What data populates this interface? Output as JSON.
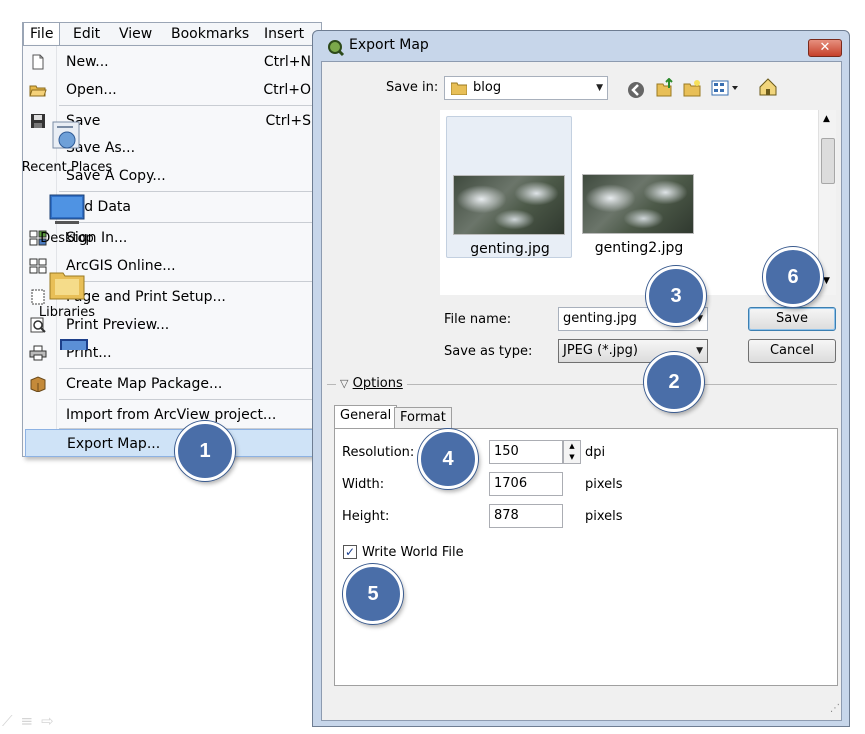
{
  "menubar": {
    "items": [
      "File",
      "Edit",
      "View",
      "Bookmarks",
      "Insert"
    ]
  },
  "file_menu": {
    "items": [
      {
        "label": "New...",
        "shortcut": "Ctrl+N",
        "icon": "new-document-icon"
      },
      {
        "label": "Open...",
        "shortcut": "Ctrl+O",
        "icon": "open-folder-icon"
      },
      {
        "label": "Save",
        "shortcut": "Ctrl+S",
        "icon": "save-disk-icon"
      },
      {
        "label": "Save As...",
        "shortcut": "",
        "icon": ""
      },
      {
        "label": "Save A Copy...",
        "shortcut": "",
        "icon": ""
      },
      {
        "label": "Add Data",
        "shortcut": "",
        "icon": ""
      },
      {
        "label": "Sign In...",
        "shortcut": "",
        "icon": "sign-in-icon"
      },
      {
        "label": "ArcGIS Online...",
        "shortcut": "",
        "icon": "arcgis-online-icon"
      },
      {
        "label": "Page and Print Setup...",
        "shortcut": "",
        "icon": "page-setup-icon"
      },
      {
        "label": "Print Preview...",
        "shortcut": "",
        "icon": "print-preview-icon"
      },
      {
        "label": "Print...",
        "shortcut": "",
        "icon": "printer-icon"
      },
      {
        "label": "Create Map Package...",
        "shortcut": "",
        "icon": "map-package-icon"
      },
      {
        "label": "Import from ArcView project...",
        "shortcut": "",
        "icon": ""
      },
      {
        "label": "Export Map...",
        "shortcut": "",
        "icon": "",
        "highlighted": true
      }
    ]
  },
  "dialog": {
    "title": "Export Map",
    "close_label": "✕",
    "save_in_label": "Save in:",
    "save_in_value": "blog",
    "places": [
      "Recent Places",
      "Desktop",
      "Libraries"
    ],
    "files": [
      "genting.jpg",
      "genting2.jpg"
    ],
    "file_name_label": "File name:",
    "file_name_value": "genting.jpg",
    "save_as_type_label": "Save as type:",
    "save_as_type_value": "JPEG (*.jpg)",
    "save_button": "Save",
    "cancel_button": "Cancel",
    "options_label": "Options",
    "tabs": [
      "General",
      "Format"
    ],
    "resolution_label": "Resolution:",
    "resolution_value": "150",
    "resolution_unit": "dpi",
    "width_label": "Width:",
    "width_value": "1706",
    "width_unit": "pixels",
    "height_label": "Height:",
    "height_value": "878",
    "height_unit": "pixels",
    "world_file_label": "Write World File",
    "world_file_checked": true
  },
  "callouts": [
    "1",
    "2",
    "3",
    "4",
    "5",
    "6"
  ],
  "colors": {
    "callout": "#4a6ea8",
    "titlebar": "#c7d6ea",
    "menu_highlight": "#cfe3f7",
    "close_button": "#c6412b"
  }
}
